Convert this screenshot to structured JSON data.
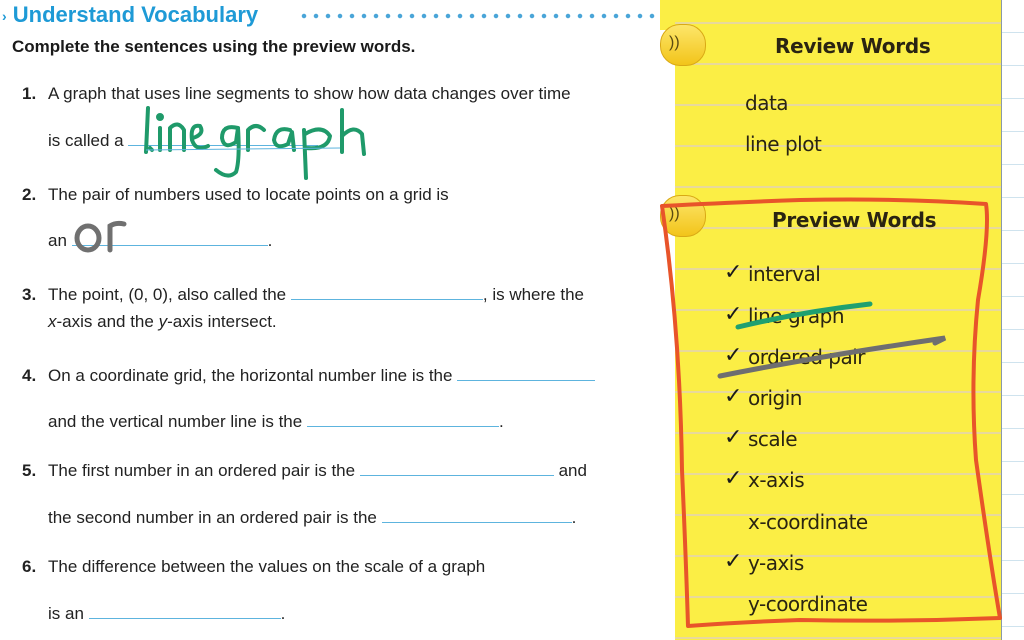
{
  "worksheet": {
    "title": "Understand Vocabulary",
    "instructions": "Complete the sentences using the preview words.",
    "questions": [
      {
        "num": "1.",
        "line1": "A graph that uses line segments to show how data changes over time",
        "line2_pre": "is called a",
        "line2_post": ".",
        "answer": "line graph"
      },
      {
        "num": "2.",
        "line1": "The pair of numbers used to locate points on a grid is",
        "line2_pre": "an",
        "line2_post": ".",
        "answer": "or"
      },
      {
        "num": "3.",
        "line1_pre": "The point, (0, 0), also called the",
        "line1_post": ", is where the",
        "line2": "x-axis and the y-axis intersect.",
        "line2_x": "x",
        "line2_mid": "-axis and the ",
        "line2_y": "y",
        "line2_end": "-axis intersect."
      },
      {
        "num": "4.",
        "line1": "On a coordinate grid, the horizontal number line is the",
        "line2_pre": "and the vertical number line is the",
        "line2_post": "."
      },
      {
        "num": "5.",
        "line1_pre": "The first number in an ordered pair is the",
        "line1_post": "and",
        "line2_pre": "the second number in an ordered pair is the",
        "line2_post": "."
      },
      {
        "num": "6.",
        "line1": "The difference between the values on the scale of a graph",
        "line2_pre": "is an",
        "line2_post": "."
      }
    ]
  },
  "review_words": {
    "title": "Review Words",
    "items": [
      "data",
      "line plot"
    ]
  },
  "preview_words": {
    "title": "Preview Words",
    "items": [
      {
        "label": "interval",
        "checked": true
      },
      {
        "label": "line graph",
        "checked": true,
        "struck": true
      },
      {
        "label": "ordered pair",
        "checked": true,
        "struck": true
      },
      {
        "label": "origin",
        "checked": true
      },
      {
        "label": "scale",
        "checked": true
      },
      {
        "label": "x-axis",
        "checked": true
      },
      {
        "label": "x-coordinate",
        "checked": false
      },
      {
        "label": "y-axis",
        "checked": true
      },
      {
        "label": "y-coordinate",
        "checked": false
      }
    ]
  },
  "icons": {
    "speaker": "speaker-icon",
    "check": "✓",
    "title_arrow": "›"
  },
  "colors": {
    "title_blue": "#1e9ad6",
    "note_yellow": "#fbee45",
    "ink_green": "#1f9a6a",
    "ink_gray": "#6e6e6e",
    "ink_orange": "#e8542a"
  }
}
